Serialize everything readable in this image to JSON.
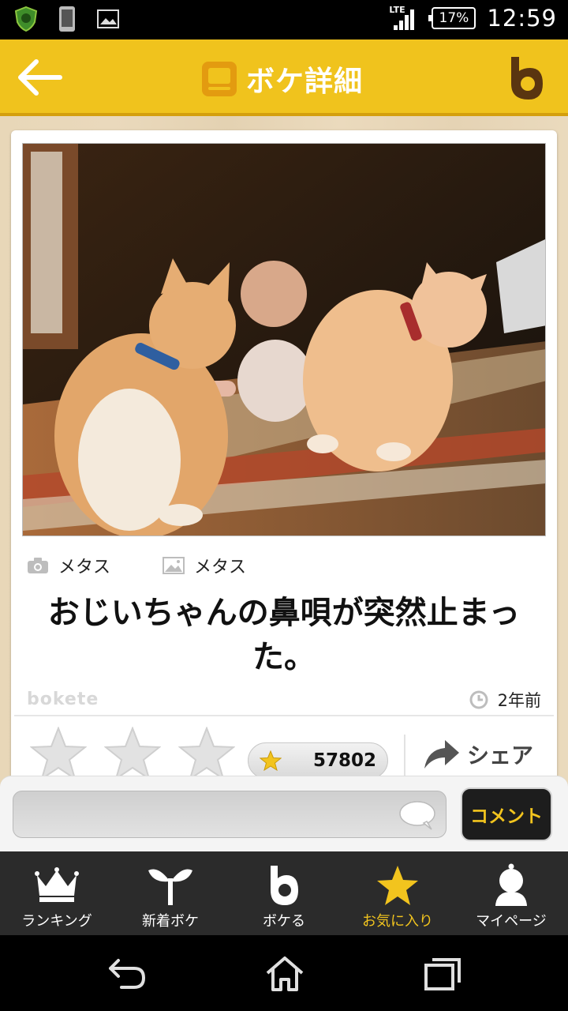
{
  "status_bar": {
    "network": "LTE",
    "battery": "17%",
    "time": "12:59",
    "icons": [
      "shield-app-icon",
      "phone-icon",
      "image-icon"
    ]
  },
  "header": {
    "title": "ボケ詳細",
    "back_icon": "back-arrow-icon",
    "brand_icon": "bokete-logo-icon",
    "accent": "#f0c31d"
  },
  "post": {
    "photo_icon": "cat-photo",
    "photo_credit": "メタス",
    "image_credit": "メタス",
    "caption": "おじいちゃんの鼻唄が突然止まった。",
    "watermark": "bokete",
    "posted": "2年前",
    "rating_stars": 3,
    "score": "57802",
    "share_label": "シェア"
  },
  "comment": {
    "placeholder": "",
    "button_label": "コメント"
  },
  "tabs": [
    {
      "label": "ランキング",
      "icon": "crown-icon",
      "active": false
    },
    {
      "label": "新着ボケ",
      "icon": "sprout-icon",
      "active": false
    },
    {
      "label": "ボケる",
      "icon": "bokete-b-icon",
      "active": false
    },
    {
      "label": "お気に入り",
      "icon": "star-icon",
      "active": true
    },
    {
      "label": "マイページ",
      "icon": "user-icon",
      "active": false
    }
  ],
  "colors": {
    "active_tab": "#f2c41e",
    "tabbar_bg": "#2b2b2b"
  }
}
